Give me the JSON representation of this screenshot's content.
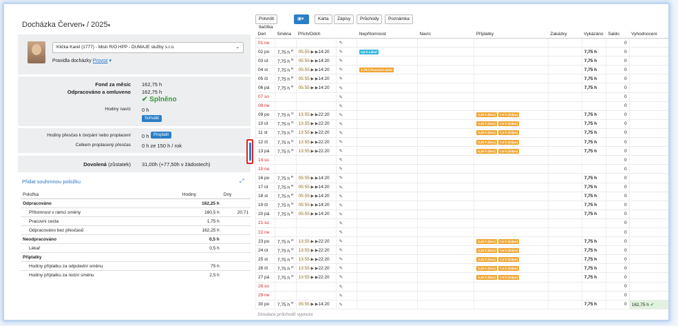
{
  "page_title": {
    "month": "Docházka Červen",
    "year": "2025"
  },
  "employee": {
    "selected": "Klička Karel (1777) - Mistr R/O HPP - DUMAJE služby s.r.o.",
    "rules_label": "Pravidla docházky",
    "rules_link": "Provoz"
  },
  "summary": {
    "fond_label": "Fond za měsíc",
    "fond_value": "162,75 h",
    "odpr_label": "Odpracováno a omluveno",
    "odpr_value": "162,75 h",
    "status": "Splněno",
    "navic_label": "Hodiny navíc",
    "navic_value": "0 h",
    "approve_btn": "Schválit"
  },
  "overtime": {
    "cerpani_label": "Hodiny přesčas k čerpání nebo proplacení",
    "cerpani_value": "0 h",
    "pay_btn": "Proplatit",
    "celkem_label": "Celkem proplacený přesčas",
    "celkem_value": "0 h ze 150 h / rok"
  },
  "vacation": {
    "label": "Dovolená",
    "label_suffix": "(zůstatek)",
    "value": "31,00h (+77,50h v žádostech)"
  },
  "add_summary_link": "Přidat souhrnnou položku",
  "sum_table": {
    "headers": [
      "Položka",
      "Hodiny",
      "Dny"
    ],
    "rows": [
      {
        "label": "Odpracováno",
        "hours": "162,25 h",
        "days": "",
        "group": true
      },
      {
        "label": "Přítomnost v rámci směny",
        "hours": "160,5 h",
        "days": "20,71",
        "group": false
      },
      {
        "label": "Pracovní cesta",
        "hours": "1,75 h",
        "days": "",
        "group": false
      },
      {
        "label": "Odpracováno bez přesčasů",
        "hours": "162,25 h",
        "days": "",
        "group": false
      },
      {
        "label": "Neodpracováno",
        "hours": "0,5 h",
        "days": "",
        "group": true
      },
      {
        "label": "Lékař",
        "hours": "0,5 h",
        "days": "",
        "group": false
      },
      {
        "label": "Příplatky",
        "hours": "",
        "days": "",
        "group": true
      },
      {
        "label": "Hodiny příplatku za odpolední směnu",
        "hours": "75 h",
        "days": "",
        "group": false
      },
      {
        "label": "Hodiny příplatku za noční směnu",
        "hours": "2,5 h",
        "days": "",
        "group": false
      }
    ]
  },
  "toolbar": {
    "confirm": "Potvrdit tlačítka",
    "karta": "Karta",
    "zapisy": "Zápisy",
    "pruchody": "Průchody",
    "poznamka": "Poznámka"
  },
  "grid": {
    "headers": [
      "Den",
      "Směna",
      "Přích/Odch",
      "",
      "Nepřítomnost",
      "Navíc",
      "Příplatky",
      "Zakázky",
      "Vykázáno",
      "Saldo",
      "Vyhodnocení"
    ],
    "rows": [
      {
        "day": "01 ne",
        "weekend": true,
        "shift": "",
        "mark": "",
        "in": "",
        "out": "",
        "absence": [],
        "extra": [],
        "rep": "",
        "saldo": "0",
        "eval": ""
      },
      {
        "day": "02 po",
        "weekend": false,
        "shift": "7,75 h",
        "mark": "R",
        "in": "05:55",
        "out": "14:20",
        "absence": [
          {
            "t": "0,5 h Lékař",
            "c": "cyan"
          }
        ],
        "extra": [],
        "rep": "7,75 h",
        "saldo": "0",
        "eval": ""
      },
      {
        "day": "03 út",
        "weekend": false,
        "shift": "7,75 h",
        "mark": "R",
        "in": "05:55",
        "out": "14:20",
        "absence": [],
        "extra": [],
        "rep": "7,75 h",
        "saldo": "0",
        "eval": ""
      },
      {
        "day": "04 st",
        "weekend": false,
        "shift": "7,75 h",
        "mark": "R",
        "in": "05:55",
        "out": "14:20",
        "absence": [
          {
            "t": "1,75 h Pracovní cesta",
            "c": "orange"
          }
        ],
        "extra": [],
        "rep": "7,75 h",
        "saldo": "0",
        "eval": ""
      },
      {
        "day": "05 čt",
        "weekend": false,
        "shift": "7,75 h",
        "mark": "R",
        "in": "05:55",
        "out": "14:20",
        "absence": [],
        "extra": [],
        "rep": "7,75 h",
        "saldo": "0",
        "eval": ""
      },
      {
        "day": "06 pá",
        "weekend": false,
        "shift": "7,75 h",
        "mark": "R",
        "in": "05:55",
        "out": "14:20",
        "absence": [],
        "extra": [],
        "rep": "7,75 h",
        "saldo": "0",
        "eval": ""
      },
      {
        "day": "07 so",
        "weekend": true,
        "shift": "",
        "mark": "",
        "in": "",
        "out": "",
        "absence": [],
        "extra": [],
        "rep": "",
        "saldo": "0",
        "eval": ""
      },
      {
        "day": "08 ne",
        "weekend": true,
        "shift": "",
        "mark": "",
        "in": "",
        "out": "",
        "absence": [],
        "extra": [],
        "rep": "",
        "saldo": "0",
        "eval": ""
      },
      {
        "day": "09 po",
        "weekend": false,
        "shift": "7,75 h",
        "mark": "O",
        "in": "13:55",
        "out": "22:20",
        "absence": [],
        "extra": [
          "0,25 h (Noc)",
          "7,5 h (Odpo)"
        ],
        "rep": "7,75 h",
        "saldo": "0",
        "eval": ""
      },
      {
        "day": "10 út",
        "weekend": false,
        "shift": "7,75 h",
        "mark": "O",
        "in": "13:55",
        "out": "22:20",
        "absence": [],
        "extra": [
          "0,25 h (Noc)",
          "7,5 h (Odpo)"
        ],
        "rep": "7,75 h",
        "saldo": "0",
        "eval": ""
      },
      {
        "day": "11 st",
        "weekend": false,
        "shift": "7,75 h",
        "mark": "O",
        "in": "13:55",
        "out": "22:20",
        "absence": [],
        "extra": [
          "0,25 h (Noc)",
          "7,5 h (Odpo)"
        ],
        "rep": "7,75 h",
        "saldo": "0",
        "eval": ""
      },
      {
        "day": "12 čt",
        "weekend": false,
        "shift": "7,75 h",
        "mark": "O",
        "in": "13:55",
        "out": "22:20",
        "absence": [],
        "extra": [
          "0,25 h (Noc)",
          "7,5 h (Odpo)"
        ],
        "rep": "7,75 h",
        "saldo": "0",
        "eval": ""
      },
      {
        "day": "13 pá",
        "weekend": false,
        "shift": "7,75 h",
        "mark": "O",
        "in": "13:55",
        "out": "22:20",
        "absence": [],
        "extra": [
          "0,25 h (Noc)",
          "7,5 h (Odpo)"
        ],
        "rep": "7,75 h",
        "saldo": "0",
        "eval": ""
      },
      {
        "day": "14 so",
        "weekend": true,
        "shift": "",
        "mark": "",
        "in": "",
        "out": "",
        "absence": [],
        "extra": [],
        "rep": "",
        "saldo": "0",
        "eval": ""
      },
      {
        "day": "15 ne",
        "weekend": true,
        "shift": "",
        "mark": "",
        "in": "",
        "out": "",
        "absence": [],
        "extra": [],
        "rep": "",
        "saldo": "0",
        "eval": ""
      },
      {
        "day": "16 po",
        "weekend": false,
        "shift": "7,75 h",
        "mark": "R",
        "in": "05:55",
        "out": "14:20",
        "absence": [],
        "extra": [],
        "rep": "7,75 h",
        "saldo": "0",
        "eval": ""
      },
      {
        "day": "17 út",
        "weekend": false,
        "shift": "7,75 h",
        "mark": "R",
        "in": "05:55",
        "out": "14:20",
        "absence": [],
        "extra": [],
        "rep": "7,75 h",
        "saldo": "0",
        "eval": ""
      },
      {
        "day": "18 st",
        "weekend": false,
        "shift": "7,75 h",
        "mark": "R",
        "in": "05:55",
        "out": "14:20",
        "absence": [],
        "extra": [],
        "rep": "7,75 h",
        "saldo": "0",
        "eval": ""
      },
      {
        "day": "19 čt",
        "weekend": false,
        "shift": "7,75 h",
        "mark": "R",
        "in": "05:55",
        "out": "14:20",
        "absence": [],
        "extra": [],
        "rep": "7,75 h",
        "saldo": "0",
        "eval": ""
      },
      {
        "day": "20 pá",
        "weekend": false,
        "shift": "7,75 h",
        "mark": "R",
        "in": "05:55",
        "out": "14:20",
        "absence": [],
        "extra": [],
        "rep": "7,75 h",
        "saldo": "0",
        "eval": ""
      },
      {
        "day": "21 so",
        "weekend": true,
        "shift": "",
        "mark": "",
        "in": "",
        "out": "",
        "absence": [],
        "extra": [],
        "rep": "",
        "saldo": "0",
        "eval": ""
      },
      {
        "day": "22 ne",
        "weekend": true,
        "shift": "",
        "mark": "",
        "in": "",
        "out": "",
        "absence": [],
        "extra": [],
        "rep": "",
        "saldo": "0",
        "eval": ""
      },
      {
        "day": "23 po",
        "weekend": false,
        "shift": "7,75 h",
        "mark": "O",
        "in": "13:55",
        "out": "22:20",
        "absence": [],
        "extra": [
          "0,25 h (Noc)",
          "7,5 h (Odpo)"
        ],
        "rep": "7,75 h",
        "saldo": "0",
        "eval": ""
      },
      {
        "day": "24 út",
        "weekend": false,
        "shift": "7,75 h",
        "mark": "O",
        "in": "13:55",
        "out": "22:20",
        "absence": [],
        "extra": [
          "0,25 h (Noc)",
          "7,5 h (Odpo)"
        ],
        "rep": "7,75 h",
        "saldo": "0",
        "eval": ""
      },
      {
        "day": "25 st",
        "weekend": false,
        "shift": "7,75 h",
        "mark": "O",
        "in": "13:55",
        "out": "22:20",
        "absence": [],
        "extra": [
          "0,25 h (Noc)",
          "7,5 h (Odpo)"
        ],
        "rep": "7,75 h",
        "saldo": "0",
        "eval": ""
      },
      {
        "day": "26 čt",
        "weekend": false,
        "shift": "7,75 h",
        "mark": "O",
        "in": "13:55",
        "out": "22:20",
        "absence": [],
        "extra": [
          "0,25 h (Noc)",
          "7,5 h (Odpo)"
        ],
        "rep": "7,75 h",
        "saldo": "0",
        "eval": ""
      },
      {
        "day": "27 pá",
        "weekend": false,
        "shift": "7,75 h",
        "mark": "O",
        "in": "13:55",
        "out": "22:20",
        "absence": [],
        "extra": [
          "0,25 h (Noc)",
          "7,5 h (Odpo)"
        ],
        "rep": "7,75 h",
        "saldo": "0",
        "eval": ""
      },
      {
        "day": "28 so",
        "weekend": true,
        "shift": "",
        "mark": "",
        "in": "",
        "out": "",
        "absence": [],
        "extra": [],
        "rep": "",
        "saldo": "0",
        "eval": ""
      },
      {
        "day": "29 ne",
        "weekend": true,
        "shift": "",
        "mark": "",
        "in": "",
        "out": "",
        "absence": [],
        "extra": [],
        "rep": "",
        "saldo": "0",
        "eval": ""
      },
      {
        "day": "30 po",
        "weekend": false,
        "shift": "7,75 h",
        "mark": "R",
        "in": "05:55",
        "out": "14:20",
        "absence": [],
        "extra": [],
        "rep": "7,75 h",
        "saldo": "0",
        "eval": "162,75 h"
      }
    ]
  },
  "footer_note": "Simulace průchodů vypnuta",
  "colors": {
    "accent": "#2a7ec7",
    "success": "#3a963a",
    "weekend": "#dd2222",
    "tag_cyan": "#35b7e0",
    "tag_orange": "#f0a531",
    "frame_glow": "#a9c8ec"
  }
}
